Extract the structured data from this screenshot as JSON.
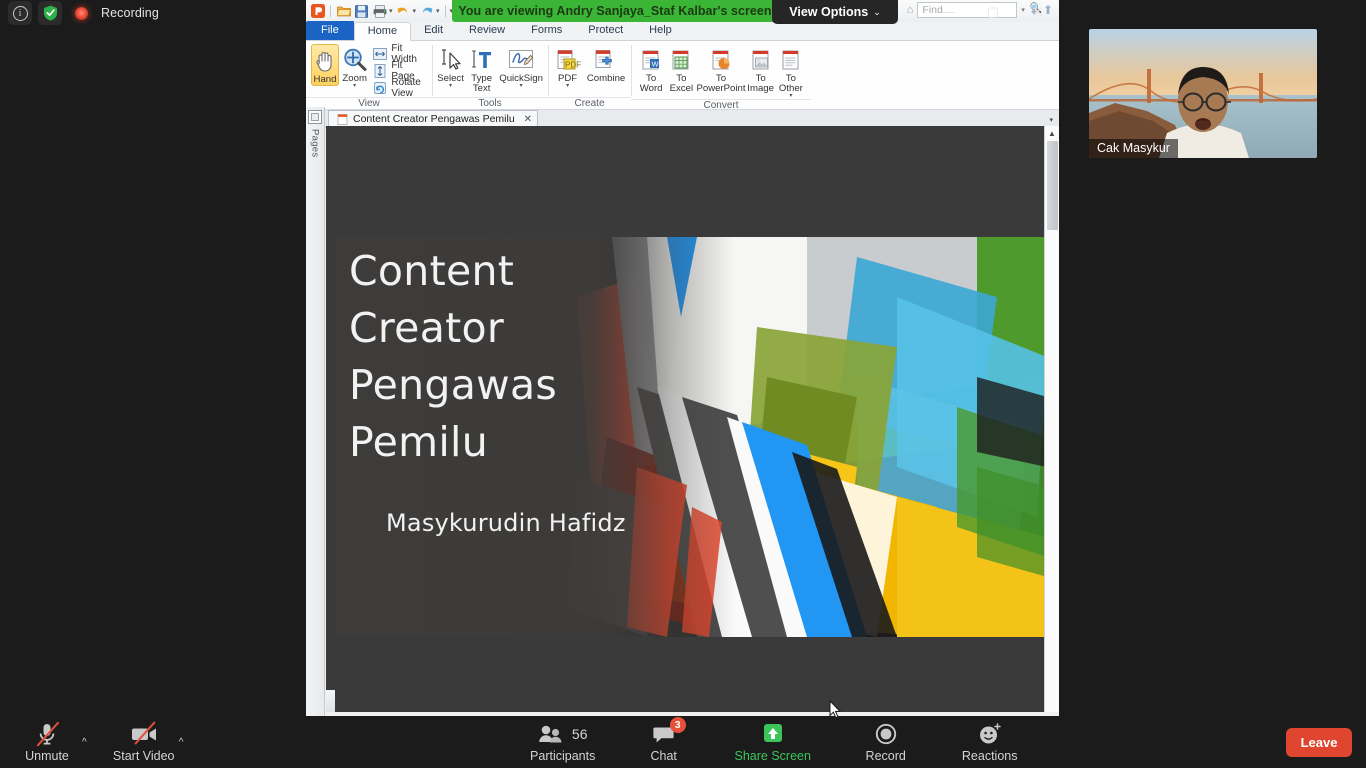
{
  "zoom_topbar": {
    "info_icon": "info-icon",
    "shield_icon": "security-shield-icon",
    "recording_icon": "recording-dot-icon",
    "recording_label": "Recording"
  },
  "share_banner": {
    "text": "You are viewing Andry Sanjaya_Staf Kalbar's screen",
    "view_options_label": "View Options",
    "view_options_caret": "⌄",
    "color": "#3bb536"
  },
  "window_controls": {
    "minimize": "—",
    "maximize": "▢",
    "close": "✕"
  },
  "pdf_app": {
    "quick_access": [
      {
        "name": "app-logo-icon",
        "glyph": "P"
      },
      {
        "name": "open-folder-icon",
        "glyph": "📂"
      },
      {
        "name": "save-icon",
        "glyph": "💾"
      },
      {
        "name": "print-icon",
        "glyph": "🖨"
      },
      {
        "name": "undo-icon",
        "glyph": "↶"
      },
      {
        "name": "redo-icon",
        "glyph": "↷"
      },
      {
        "name": "customize-qat-icon",
        "glyph": "⌄"
      }
    ],
    "tabs": [
      {
        "label": "File",
        "active": false,
        "file": true
      },
      {
        "label": "Home",
        "active": true
      },
      {
        "label": "Edit",
        "active": false
      },
      {
        "label": "Review",
        "active": false
      },
      {
        "label": "Forms",
        "active": false
      },
      {
        "label": "Protect",
        "active": false
      },
      {
        "label": "Help",
        "active": false
      }
    ],
    "find": {
      "placeholder": "Find",
      "home_icon": "home-icon",
      "search_icon": "search-icon",
      "dropdown_caret": "▾",
      "prev_icon": "find-previous-icon",
      "next_icon": "find-next-icon"
    },
    "ribbon_groups": [
      {
        "label": "View",
        "big_buttons": [
          {
            "label": "Hand",
            "icon": "hand-icon",
            "selected": true
          },
          {
            "label": "Zoom",
            "icon": "zoom-magnifier-icon",
            "caret": true
          }
        ],
        "small_buttons": [
          {
            "label": "Fit Width",
            "icon": "fit-width-icon"
          },
          {
            "label": "Fit Page",
            "icon": "fit-page-icon"
          },
          {
            "label": "Rotate View",
            "icon": "rotate-view-icon"
          }
        ]
      },
      {
        "label": "Tools",
        "big_buttons": [
          {
            "label": "Select",
            "icon": "select-cursor-icon",
            "caret": true
          },
          {
            "label": "Type Text",
            "icon": "type-text-icon"
          },
          {
            "label": "QuickSign",
            "icon": "quicksign-icon",
            "caret": true
          }
        ],
        "small_buttons": []
      },
      {
        "label": "Create",
        "big_buttons": [
          {
            "label": "PDF",
            "icon": "create-pdf-icon",
            "caret": true
          },
          {
            "label": "Combine",
            "icon": "combine-files-icon"
          }
        ],
        "small_buttons": []
      },
      {
        "label": "Convert",
        "big_buttons": [
          {
            "label": "To Word",
            "icon": "to-word-icon"
          },
          {
            "label": "To Excel",
            "icon": "to-excel-icon"
          },
          {
            "label": "To PowerPoint",
            "icon": "to-powerpoint-icon"
          },
          {
            "label": "To Image",
            "icon": "to-image-icon"
          },
          {
            "label": "To Other",
            "icon": "to-other-icon",
            "caret": true
          }
        ],
        "small_buttons": []
      }
    ],
    "document_tab": {
      "title": "Content Creator Pengawas Pemilu",
      "close_glyph": "✕",
      "file_icon": "pdf-document-icon",
      "overflow_caret": "▾"
    },
    "pages_panel": {
      "label": "Pages",
      "icon": "pages-thumbnail-icon"
    },
    "scrollbar": {
      "up_arrow": "▲",
      "down_arrow": "▼"
    }
  },
  "slide": {
    "title_lines": [
      "Content",
      "Creator",
      "Pengawas",
      "Pemilu"
    ],
    "author": "Masykurudin Hafidz",
    "bg_colors": [
      "#4aa3dd",
      "#1f9de0",
      "#f5c518",
      "#f0b400",
      "#6aa92e",
      "#4e9b2a",
      "#d94f33",
      "#8c2a1c",
      "#58c2e0",
      "#9aa0a4",
      "#f2f2f0"
    ]
  },
  "video_tile": {
    "participant_name": "Cak Masykur"
  },
  "zoom_bottombar": {
    "items": [
      {
        "label": "Unmute",
        "icon": "microphone-muted-icon",
        "caret": "^",
        "highlight": false
      },
      {
        "label": "Start Video",
        "icon": "video-camera-off-icon",
        "caret": "^",
        "highlight": false
      },
      {
        "label": "Participants",
        "icon": "participants-icon",
        "count": "56",
        "highlight": false
      },
      {
        "label": "Chat",
        "icon": "chat-bubble-icon",
        "badge": "3",
        "highlight": false
      },
      {
        "label": "Share Screen",
        "icon": "share-screen-icon",
        "highlight": true
      },
      {
        "label": "Record",
        "icon": "record-circle-icon",
        "highlight": false
      },
      {
        "label": "Reactions",
        "icon": "reactions-smiley-icon",
        "highlight": false
      }
    ],
    "leave_label": "Leave",
    "share_screen_color": "#3cc45b",
    "leave_color": "#e0452f"
  }
}
